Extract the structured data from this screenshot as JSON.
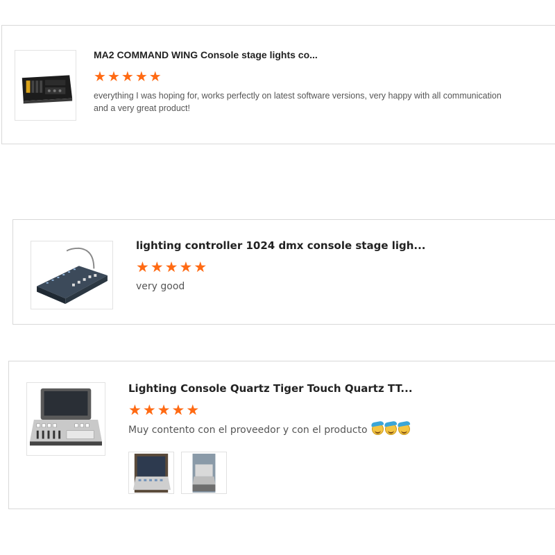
{
  "reviews": [
    {
      "title": "MA2 COMMAND WING Console stage lights co...",
      "rating": 5,
      "text": "everything I was hoping for, works perfectly on latest software versions, very happy with all communication and a very great product!",
      "thumb_icon": "lighting-console-wing-icon"
    },
    {
      "title": "lighting controller 1024 dmx console stage ligh...",
      "rating": 5,
      "text": "very good",
      "thumb_icon": "dmx-console-icon"
    },
    {
      "title": "Lighting Console Quartz Tiger Touch Quartz TT...",
      "rating": 5,
      "text": "Muy contento con el proveedor y con el producto",
      "emoji_count": 3,
      "thumb_icon": "tiger-touch-console-icon",
      "photos": [
        "review-photo-1",
        "review-photo-2"
      ]
    }
  ],
  "colors": {
    "star": "#ff6a13",
    "border": "#d8d8d8",
    "title": "#222222",
    "text": "#555555"
  }
}
